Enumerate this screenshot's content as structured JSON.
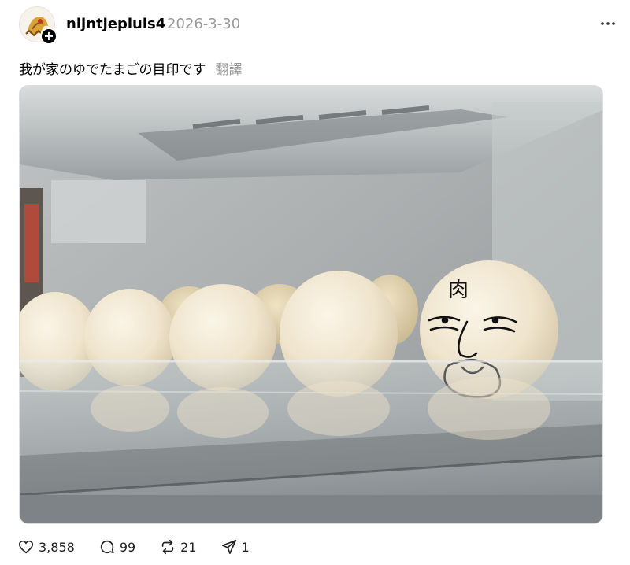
{
  "post": {
    "username": "nijntjepluis4",
    "timestamp": "2026-3-30",
    "text": "我が家のゆでたまごの目印です",
    "translate_label": "翻譯",
    "egg_drawing_text": "肉"
  },
  "actions": {
    "likes": "3,858",
    "replies": "99",
    "reposts": "21",
    "shares": "1"
  },
  "icons": {
    "like": "heart-icon",
    "reply": "comment-icon",
    "repost": "repost-icon",
    "share": "send-icon",
    "more": "more-dots-icon",
    "follow": "plus-icon"
  },
  "colors": {
    "text": "#000000",
    "muted": "#999999"
  }
}
